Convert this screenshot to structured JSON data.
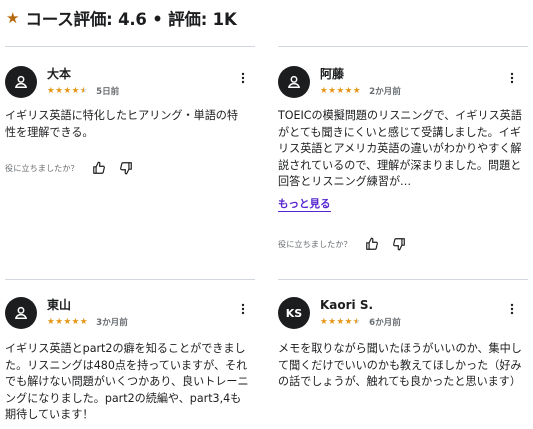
{
  "header": {
    "title": "コース評価: 4.6 • 評価: 1K",
    "star_icon": "star-icon"
  },
  "colors": {
    "star": "#e59819",
    "accent": "#5624d0",
    "text": "#1c1d1f",
    "muted": "#6a6f73"
  },
  "reviews": [
    {
      "name": "大本",
      "avatar": "user-icon",
      "rating": 4.5,
      "stars_text": "★★★★★",
      "date": "5日前",
      "text": "イギリス英語に特化したヒアリング・単語の特性を理解できる。",
      "helpful_question": "役に立ちましたか？"
    },
    {
      "name": "阿藤",
      "avatar": "user-icon",
      "rating": 5,
      "stars_text": "★★★★★",
      "date": "2か月前",
      "text": "TOEICの模擬問題のリスニングで、イギリス英語がとても聞きにくいと感じて受講しました。イギリス英語とアメリカ英語の違いがわかりやすく解説されているので、理解が深まりました。問題と回答とリスニング練習が…",
      "show_more": "もっと見る",
      "helpful_question": "役に立ちましたか？"
    },
    {
      "name": "東山",
      "avatar": "user-icon",
      "rating": 5,
      "stars_text": "★★★★★",
      "date": "3か月前",
      "text": "イギリス英語とpart2の癖を知ることができました。リスニングは480点を持っていますが、それでも解けない問題がいくつかあり、良いトレーニングになりました。part2の続編や、part3,4も期待しています！"
    },
    {
      "name": "Kaori S.",
      "avatar_initials": "KS",
      "rating": 4.5,
      "stars_text": "★★★★★",
      "date": "6か月前",
      "text": "メモを取りながら聞いたほうがいいのか、集中して聞くだけでいいのかも教えてほしかった（好みの話でしょうが、触れても良かったと思います）"
    }
  ]
}
